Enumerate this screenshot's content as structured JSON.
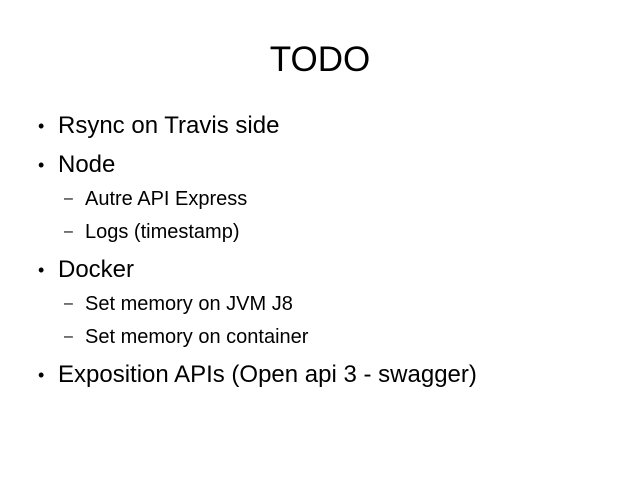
{
  "slide": {
    "title": "TODO",
    "bullet_marker": "•",
    "sub_marker": "–",
    "items": [
      {
        "label": "Rsync on Travis side",
        "children": []
      },
      {
        "label": "Node",
        "children": [
          {
            "label": "Autre API Express"
          },
          {
            "label": "Logs (timestamp)"
          }
        ]
      },
      {
        "label": "Docker",
        "children": [
          {
            "label": "Set memory on JVM J8"
          },
          {
            "label": "Set memory on container"
          }
        ]
      },
      {
        "label": "Exposition APIs (Open api 3 - swagger)",
        "children": []
      }
    ]
  }
}
